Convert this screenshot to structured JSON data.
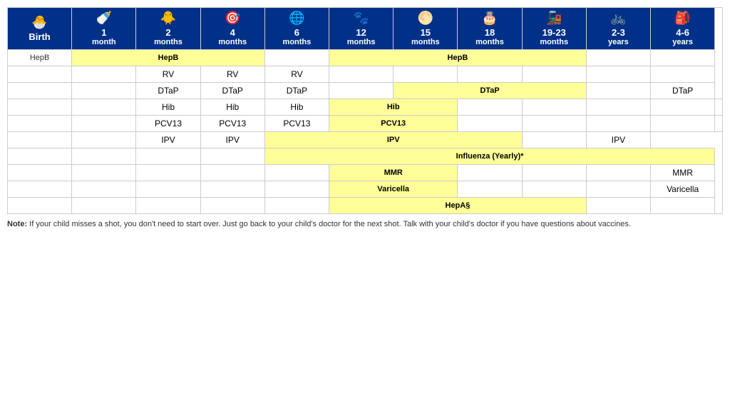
{
  "headers": [
    {
      "id": "birth",
      "icon": "🐣",
      "line1": "Birth",
      "line2": ""
    },
    {
      "id": "1mo",
      "icon": "🍼",
      "line1": "1",
      "line2": "month"
    },
    {
      "id": "2mo",
      "icon": "🐥",
      "line1": "2",
      "line2": "months"
    },
    {
      "id": "4mo",
      "icon": "🎯",
      "line1": "4",
      "line2": "months"
    },
    {
      "id": "6mo",
      "icon": "🌐",
      "line1": "6",
      "line2": "months"
    },
    {
      "id": "12mo",
      "icon": "🐾",
      "line1": "12",
      "line2": "months"
    },
    {
      "id": "15mo",
      "icon": "🌕",
      "line1": "15",
      "line2": "months"
    },
    {
      "id": "18mo",
      "icon": "🎂",
      "line1": "18",
      "line2": "months"
    },
    {
      "id": "1923mo",
      "icon": "🚂",
      "line1": "19-23",
      "line2": "months"
    },
    {
      "id": "23yr",
      "icon": "🚲",
      "line1": "2-3",
      "line2": "years"
    },
    {
      "id": "46yr",
      "icon": "🎒",
      "line1": "4-6",
      "line2": "years"
    }
  ],
  "rows": [
    {
      "vaccine": "HepB",
      "cells": [
        {
          "type": "yellow",
          "text": "HepB",
          "colspan": 3
        },
        {
          "type": "empty"
        },
        {
          "type": "yellow",
          "text": "HepB",
          "colspan": 4
        },
        {
          "type": "empty"
        },
        {
          "type": "empty"
        },
        {
          "type": "empty"
        }
      ]
    },
    {
      "vaccine": "",
      "cells": [
        {
          "type": "empty"
        },
        {
          "type": "empty"
        },
        {
          "type": "plain",
          "text": "RV"
        },
        {
          "type": "plain",
          "text": "RV"
        },
        {
          "type": "plain",
          "text": "RV"
        },
        {
          "type": "empty"
        },
        {
          "type": "empty"
        },
        {
          "type": "empty"
        },
        {
          "type": "empty"
        },
        {
          "type": "empty"
        },
        {
          "type": "empty"
        }
      ]
    },
    {
      "vaccine": "",
      "cells": [
        {
          "type": "empty"
        },
        {
          "type": "empty"
        },
        {
          "type": "plain",
          "text": "DTaP"
        },
        {
          "type": "plain",
          "text": "DTaP"
        },
        {
          "type": "plain",
          "text": "DTaP"
        },
        {
          "type": "empty"
        },
        {
          "type": "yellow",
          "text": "DTaP",
          "colspan": 3
        },
        {
          "type": "empty"
        },
        {
          "type": "plain",
          "text": "DTaP"
        }
      ]
    },
    {
      "vaccine": "",
      "cells": [
        {
          "type": "empty"
        },
        {
          "type": "empty"
        },
        {
          "type": "plain",
          "text": "Hib"
        },
        {
          "type": "plain",
          "text": "Hib"
        },
        {
          "type": "plain",
          "text": "Hib"
        },
        {
          "type": "yellow",
          "text": "Hib",
          "colspan": 2
        },
        {
          "type": "empty"
        },
        {
          "type": "empty"
        },
        {
          "type": "empty"
        },
        {
          "type": "empty"
        },
        {
          "type": "empty"
        }
      ]
    },
    {
      "vaccine": "",
      "cells": [
        {
          "type": "empty"
        },
        {
          "type": "empty"
        },
        {
          "type": "plain",
          "text": "PCV13"
        },
        {
          "type": "plain",
          "text": "PCV13"
        },
        {
          "type": "plain",
          "text": "PCV13"
        },
        {
          "type": "yellow",
          "text": "PCV13",
          "colspan": 2
        },
        {
          "type": "empty"
        },
        {
          "type": "empty"
        },
        {
          "type": "empty"
        },
        {
          "type": "empty"
        },
        {
          "type": "empty"
        }
      ]
    },
    {
      "vaccine": "",
      "cells": [
        {
          "type": "empty"
        },
        {
          "type": "empty"
        },
        {
          "type": "plain",
          "text": "IPV"
        },
        {
          "type": "plain",
          "text": "IPV"
        },
        {
          "type": "yellow",
          "text": "IPV",
          "colspan": 4
        },
        {
          "type": "empty"
        },
        {
          "type": "plain",
          "text": "IPV"
        }
      ]
    },
    {
      "vaccine": "",
      "cells": [
        {
          "type": "empty"
        },
        {
          "type": "empty"
        },
        {
          "type": "empty"
        },
        {
          "type": "empty"
        },
        {
          "type": "yellow",
          "text": "Influenza (Yearly)*",
          "colspan": 7
        }
      ]
    },
    {
      "vaccine": "",
      "cells": [
        {
          "type": "empty"
        },
        {
          "type": "empty"
        },
        {
          "type": "empty"
        },
        {
          "type": "empty"
        },
        {
          "type": "empty"
        },
        {
          "type": "yellow",
          "text": "MMR",
          "colspan": 2
        },
        {
          "type": "empty"
        },
        {
          "type": "empty"
        },
        {
          "type": "empty"
        },
        {
          "type": "plain",
          "text": "MMR"
        }
      ]
    },
    {
      "vaccine": "",
      "cells": [
        {
          "type": "empty"
        },
        {
          "type": "empty"
        },
        {
          "type": "empty"
        },
        {
          "type": "empty"
        },
        {
          "type": "empty"
        },
        {
          "type": "yellow",
          "text": "Varicella",
          "colspan": 2
        },
        {
          "type": "empty"
        },
        {
          "type": "empty"
        },
        {
          "type": "empty"
        },
        {
          "type": "plain",
          "text": "Varicella"
        }
      ]
    },
    {
      "vaccine": "",
      "cells": [
        {
          "type": "empty"
        },
        {
          "type": "empty"
        },
        {
          "type": "empty"
        },
        {
          "type": "empty"
        },
        {
          "type": "empty"
        },
        {
          "type": "yellow",
          "text": "HepA§",
          "colspan": 5
        },
        {
          "type": "empty"
        },
        {
          "type": "empty"
        }
      ]
    }
  ],
  "note": "Note: If your child misses a shot, you don't need to start over. Just go back to your child's doctor for the next shot. Talk with your child's doctor if you have questions about vaccines."
}
